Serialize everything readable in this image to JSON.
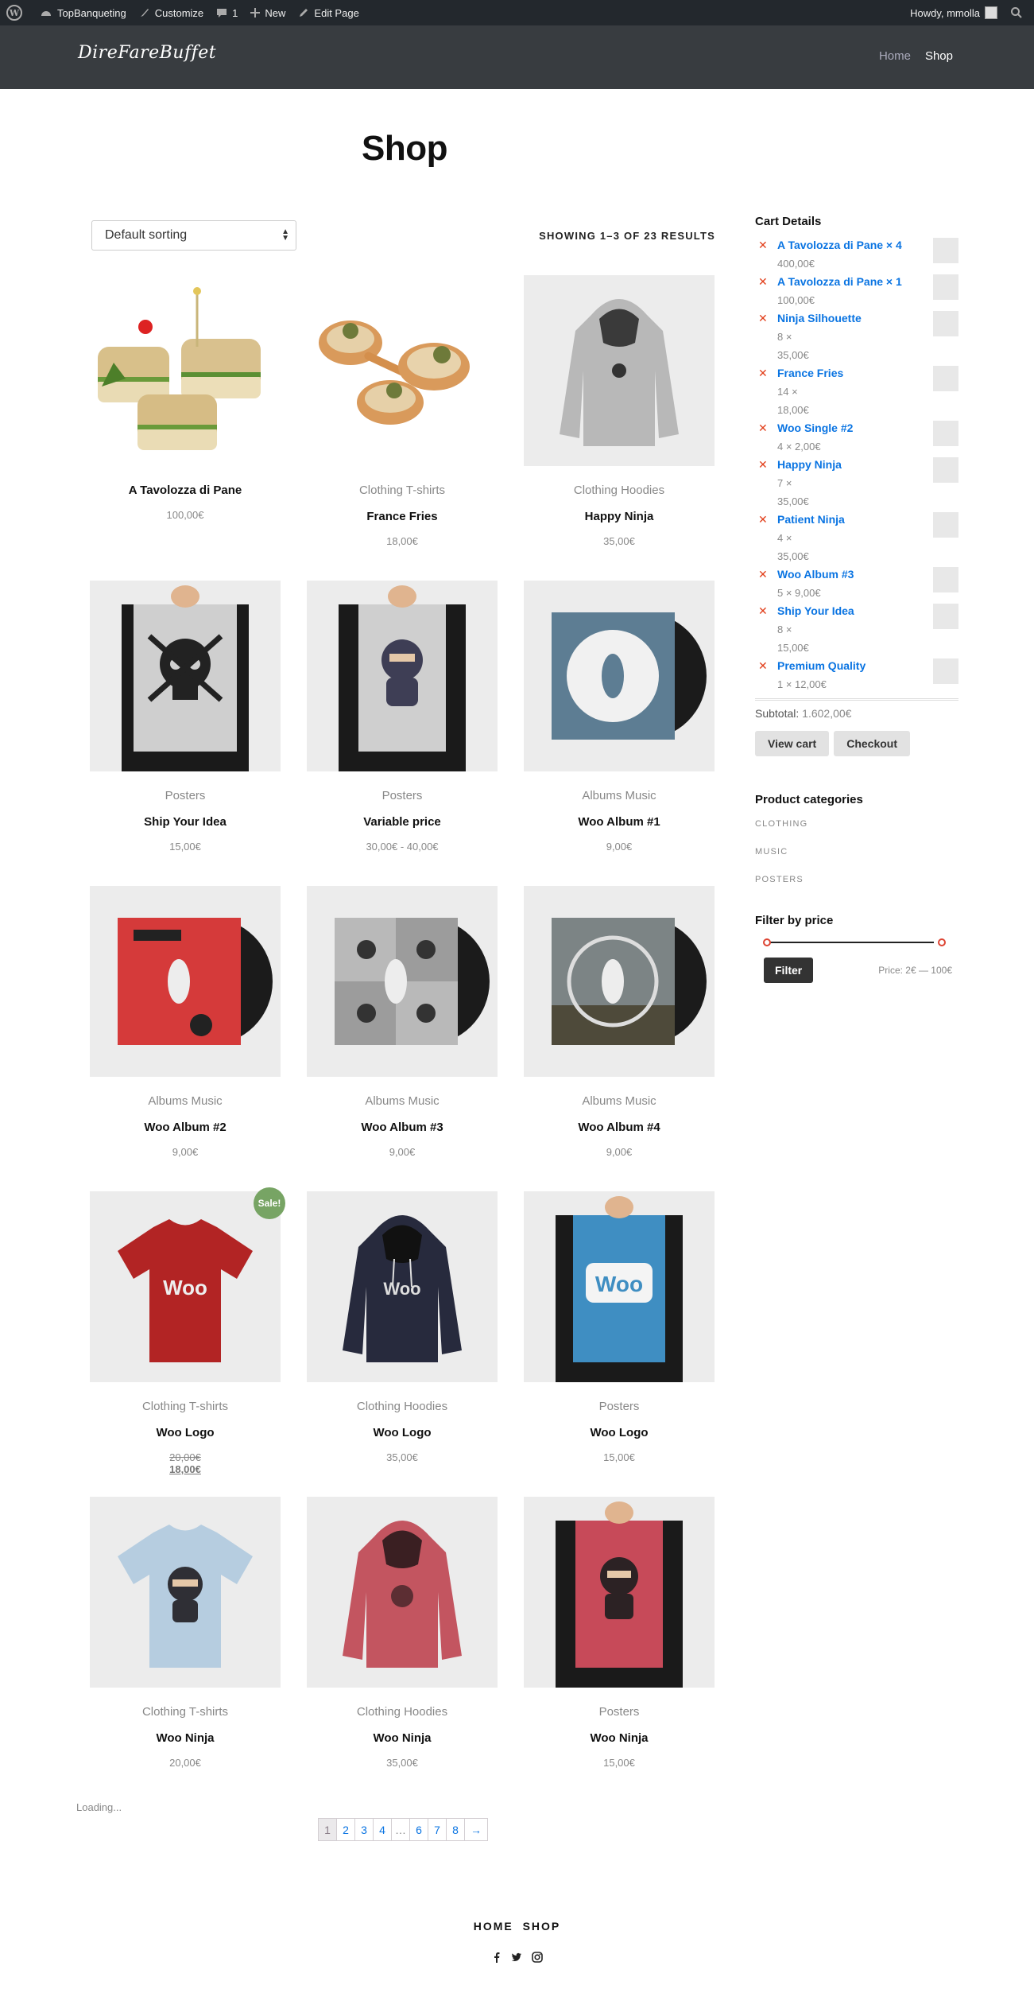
{
  "adminbar": {
    "site_name": "TopBanqueting",
    "customize": "Customize",
    "comments_count": "1",
    "new_label": "New",
    "edit_page": "Edit Page",
    "howdy": "Howdy, mmolla"
  },
  "header": {
    "logo": "DireFareBuffet",
    "nav": [
      "Home",
      "Shop"
    ]
  },
  "page": {
    "title": "Shop",
    "sort_value": "Default sorting",
    "result_count": "SHOWING 1–3 OF 23 RESULTS"
  },
  "products": [
    {
      "category": "",
      "name": "A Tavolozza di Pane",
      "price": "100,00€",
      "icon": "sandwich-image"
    },
    {
      "category": "Clothing T-shirts",
      "name": "France Fries",
      "price": "18,00€",
      "icon": "food-spoons-image"
    },
    {
      "category": "Clothing Hoodies",
      "name": "Happy Ninja",
      "price": "35,00€",
      "icon": "grey-hoodie-image"
    },
    {
      "category": "Posters",
      "name": "Ship Your Idea",
      "price": "15,00€",
      "icon": "skull-poster-image"
    },
    {
      "category": "Posters",
      "name": "Variable price",
      "price": "30,00€ - 40,00€",
      "icon": "ninja-poster-image"
    },
    {
      "category": "Albums Music",
      "name": "Woo Album #1",
      "price": "9,00€",
      "icon": "blue-album-image"
    },
    {
      "category": "Albums Music",
      "name": "Woo Album #2",
      "price": "9,00€",
      "icon": "red-album-image"
    },
    {
      "category": "Albums Music",
      "name": "Woo Album #3",
      "price": "9,00€",
      "icon": "grey-album-image"
    },
    {
      "category": "Albums Music",
      "name": "Woo Album #4",
      "price": "9,00€",
      "icon": "city-album-image"
    },
    {
      "category": "Clothing T-shirts",
      "name": "Woo Logo",
      "price_old": "20,00€",
      "price": "18,00€",
      "sale": "Sale!",
      "icon": "red-tshirt-image"
    },
    {
      "category": "Clothing Hoodies",
      "name": "Woo Logo",
      "price": "35,00€",
      "icon": "navy-hoodie-image"
    },
    {
      "category": "Posters",
      "name": "Woo Logo",
      "price": "15,00€",
      "icon": "woo-poster-image"
    },
    {
      "category": "Clothing T-shirts",
      "name": "Woo Ninja",
      "price": "20,00€",
      "icon": "lightblue-tshirt-image"
    },
    {
      "category": "Clothing Hoodies",
      "name": "Woo Ninja",
      "price": "35,00€",
      "icon": "pink-hoodie-image"
    },
    {
      "category": "Posters",
      "name": "Woo Ninja",
      "price": "15,00€",
      "icon": "pink-poster-image"
    }
  ],
  "cart": {
    "title": "Cart Details",
    "items": [
      {
        "title": "A Tavolozza di Pane × 4",
        "qty": "400,00€"
      },
      {
        "title": "A Tavolozza di Pane × 1",
        "qty": "100,00€"
      },
      {
        "title": "Ninja Silhouette",
        "qty": "8 ×",
        "qty2": "35,00€"
      },
      {
        "title": "France Fries",
        "qty": "14 ×",
        "qty2": "18,00€"
      },
      {
        "title": "Woo Single #2",
        "qty": "4 × 2,00€"
      },
      {
        "title": "Happy Ninja",
        "qty": "7 ×",
        "qty2": "35,00€"
      },
      {
        "title": "Patient Ninja",
        "qty": "4 ×",
        "qty2": "35,00€"
      },
      {
        "title": "Woo Album #3",
        "qty": "5 × 9,00€"
      },
      {
        "title": "Ship Your Idea",
        "qty": "8 ×",
        "qty2": "15,00€"
      },
      {
        "title": "Premium Quality",
        "qty": "1 × 12,00€"
      }
    ],
    "subtotal_label": "Subtotal:",
    "subtotal": "1.602,00€",
    "view_cart": "View cart",
    "checkout": "Checkout"
  },
  "categories": {
    "title": "Product categories",
    "items": [
      "CLOTHING",
      "MUSIC",
      "POSTERS"
    ]
  },
  "price_filter": {
    "title": "Filter by price",
    "button": "Filter",
    "range": "Price: 2€ — 100€"
  },
  "loading": "Loading...",
  "pagination": [
    "1",
    "2",
    "3",
    "4",
    "…",
    "6",
    "7",
    "8",
    "→"
  ],
  "footer": {
    "nav": [
      "HOME",
      "SHOP"
    ]
  },
  "colors": {
    "accent": "#0a74e2",
    "remove": "#e2401c",
    "sale": "#77a464",
    "header_bg": "#383c40",
    "adminbar_bg": "#23282d"
  }
}
